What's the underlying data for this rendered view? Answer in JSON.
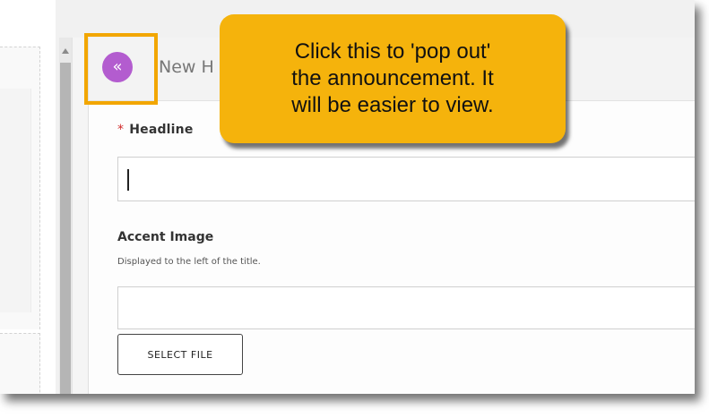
{
  "header": {
    "title": "New H"
  },
  "pop_out_button": {
    "icon": "chevron-double-left-icon",
    "glyph": "«",
    "color": "#b35ccf"
  },
  "highlight_color": "#f2a600",
  "callout": {
    "lines": [
      "Click this to 'pop out'",
      "the announcement. It",
      "will be easier to view."
    ],
    "color": "#f5b30c"
  },
  "form": {
    "headline": {
      "required_marker": "*",
      "label": "Headline",
      "value": ""
    },
    "accent_image": {
      "label": "Accent Image",
      "help": "Displayed to the left of the title.",
      "value": ""
    },
    "select_file_label": "SELECT FILE"
  }
}
